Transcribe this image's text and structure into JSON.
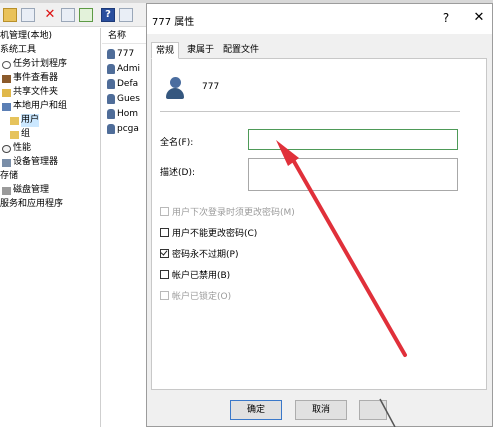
{
  "tree": {
    "items": [
      {
        "label": "机管理(本地)",
        "icon": "computer-icon"
      },
      {
        "label": "系统工具",
        "icon": "tools-icon"
      },
      {
        "label": "任务计划程序",
        "icon": "clock-icon"
      },
      {
        "label": "事件查看器",
        "icon": "event-icon"
      },
      {
        "label": "共享文件夹",
        "icon": "share-icon"
      },
      {
        "label": "本地用户和组",
        "icon": "users-icon"
      },
      {
        "label": "用户",
        "icon": "folder-icon",
        "selected": true
      },
      {
        "label": "组",
        "icon": "folder-icon"
      },
      {
        "label": "性能",
        "icon": "performance-icon"
      },
      {
        "label": "设备管理器",
        "icon": "device-icon"
      },
      {
        "label": "存储",
        "icon": "storage-icon"
      },
      {
        "label": "磁盘管理",
        "icon": "disk-icon"
      },
      {
        "label": "服务和应用程序",
        "icon": "services-icon"
      }
    ]
  },
  "list": {
    "header": "名称",
    "items": [
      "777",
      "Admi",
      "Defa",
      "Gues",
      "Hom",
      "pcga"
    ]
  },
  "dialog": {
    "title": "777 属性",
    "help_glyph": "?",
    "close_glyph": "✕",
    "tabs": [
      "常规",
      "隶属于",
      "配置文件"
    ],
    "username": "777",
    "fullname_label": "全名(F):",
    "fullname_value": "",
    "description_label": "描述(D):",
    "description_value": "",
    "checkboxes": [
      {
        "label": "用户下次登录时须更改密码(M)",
        "checked": false,
        "disabled": true
      },
      {
        "label": "用户不能更改密码(C)",
        "checked": false,
        "disabled": false
      },
      {
        "label": "密码永不过期(P)",
        "checked": true,
        "disabled": false
      },
      {
        "label": "帐户已禁用(B)",
        "checked": false,
        "disabled": false
      },
      {
        "label": "帐户已锁定(O)",
        "checked": false,
        "disabled": true
      }
    ],
    "ok_label": "确定",
    "cancel_label": "取消",
    "apply_label": ""
  },
  "annotation": {
    "arrow_color": "#e0303a"
  }
}
